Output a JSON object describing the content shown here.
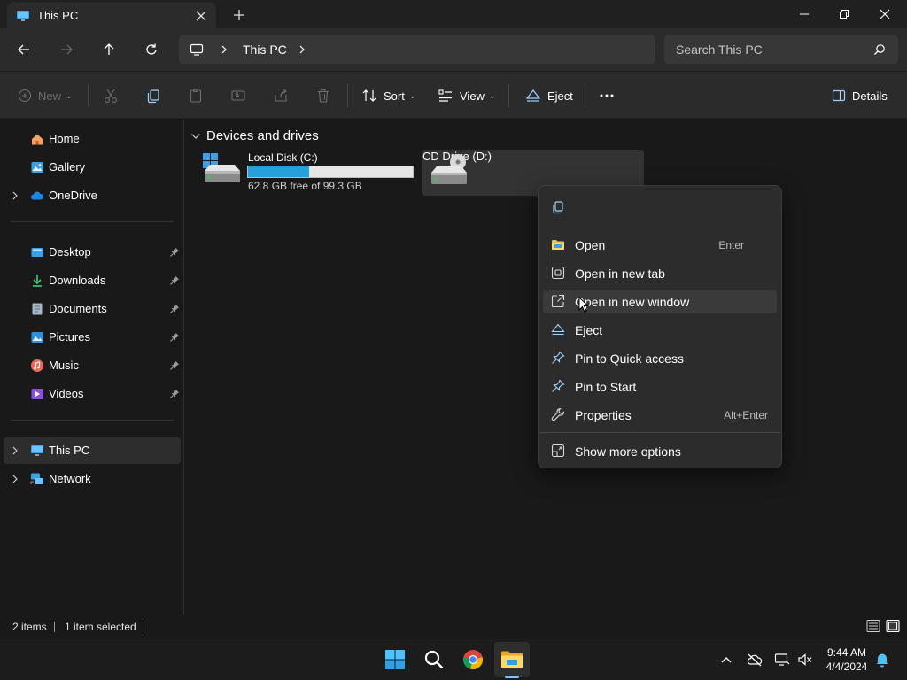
{
  "window": {
    "tab_title": "This PC"
  },
  "address": {
    "crumb": "This PC"
  },
  "search": {
    "placeholder": "Search This PC"
  },
  "toolbar": {
    "new_label": "New",
    "sort_label": "Sort",
    "view_label": "View",
    "eject_label": "Eject",
    "details_label": "Details"
  },
  "sidebar": {
    "items": [
      {
        "label": "Home"
      },
      {
        "label": "Gallery"
      },
      {
        "label": "OneDrive"
      },
      {
        "label": "Desktop"
      },
      {
        "label": "Downloads"
      },
      {
        "label": "Documents"
      },
      {
        "label": "Pictures"
      },
      {
        "label": "Music"
      },
      {
        "label": "Videos"
      },
      {
        "label": "This PC"
      },
      {
        "label": "Network"
      }
    ]
  },
  "main": {
    "group_title": "Devices and drives",
    "drives": [
      {
        "name": "Local Disk (C:)",
        "free_text": "62.8 GB free of 99.3 GB",
        "used_fraction": 0.37
      },
      {
        "name": "CD Drive (D:)"
      }
    ]
  },
  "context_menu": {
    "items": [
      {
        "label": "Open",
        "shortcut": "Enter",
        "icon": "folder-icon"
      },
      {
        "label": "Open in new tab",
        "icon": "new-tab-icon"
      },
      {
        "label": "Open in new window",
        "icon": "new-window-icon"
      },
      {
        "label": "Eject",
        "icon": "eject-icon"
      },
      {
        "label": "Pin to Quick access",
        "icon": "pin-icon"
      },
      {
        "label": "Pin to Start",
        "icon": "pin-icon"
      },
      {
        "label": "Properties",
        "shortcut": "Alt+Enter",
        "icon": "wrench-icon"
      },
      {
        "label": "Show more options",
        "icon": "more-options-icon"
      }
    ]
  },
  "status": {
    "items_count": "2 items",
    "selection": "1 item selected"
  },
  "taskbar": {
    "time": "9:44 AM",
    "date": "4/4/2024"
  },
  "colors": {
    "accent": "#26a0da",
    "folder": "#f0c03c",
    "background": "#191919"
  }
}
